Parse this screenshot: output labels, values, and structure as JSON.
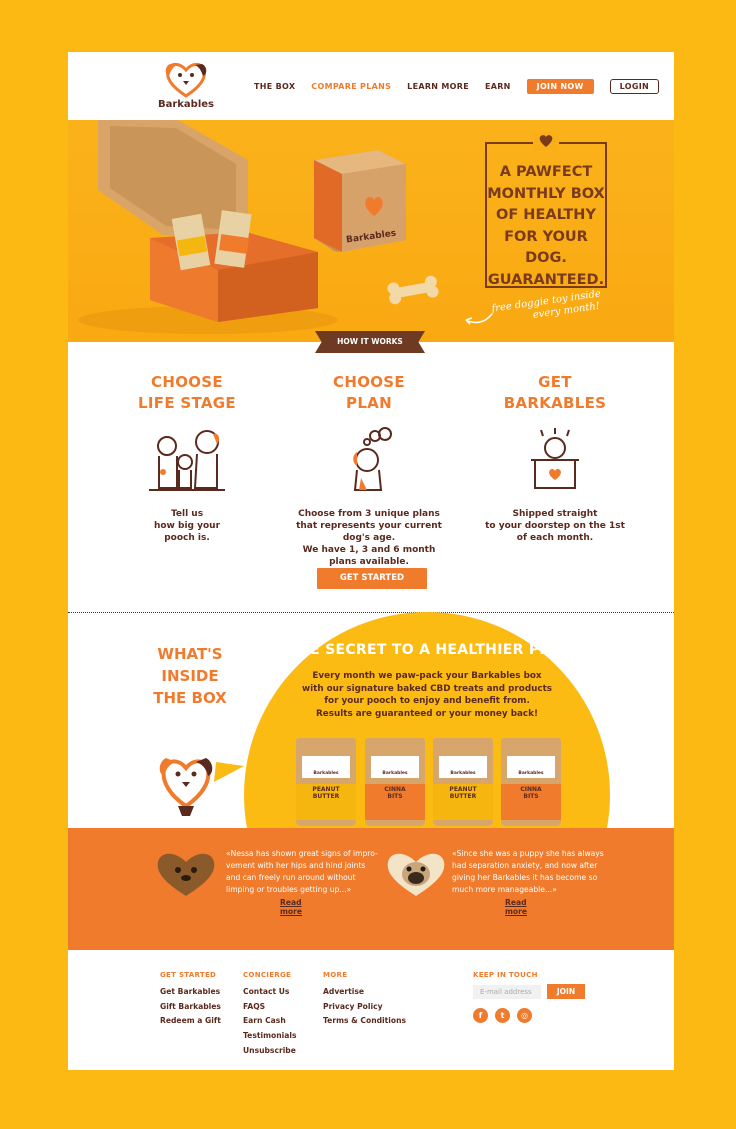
{
  "brand": {
    "name": "Barkables"
  },
  "nav": {
    "items": [
      "THE BOX",
      "COMPARE PLANS",
      "LEARN MORE",
      "EARN"
    ],
    "active_index": 1,
    "join_label": "JOIN NOW",
    "login_label": "LOGIN"
  },
  "hero": {
    "headline": [
      "A PAWFECT",
      "MONTHLY BOX",
      "OF HEALTHY",
      "FOR YOUR DOG.",
      "GUARANTEED."
    ],
    "note_line1": "free doggie toy inside",
    "note_line2": "every month!",
    "box_brand": "Barkables"
  },
  "how_it_works": {
    "tag": "HOW IT WORKS",
    "steps": [
      {
        "title1": "CHOOSE",
        "title2": "LIFE STAGE",
        "text": [
          "Tell us",
          "how big your",
          "pooch is."
        ]
      },
      {
        "title1": "CHOOSE",
        "title2": "PLAN",
        "text": [
          "Choose from 3 unique plans",
          "that represents your current dog's age.",
          "We have 1, 3 and 6 month",
          "plans available."
        ]
      },
      {
        "title1": "GET",
        "title2": "BARKABLES",
        "text": [
          "Shipped straight",
          "to your doorstep on the 1st",
          "of each month."
        ]
      }
    ],
    "cta": "GET STARTED"
  },
  "inside": {
    "title": [
      "WHAT'S",
      "INSIDE",
      "THE BOX"
    ],
    "secret_title": "THE SECRET TO A HEALTHIER PET!",
    "secret_body": [
      "Every month we paw-pack your Barkables box",
      "with our signature baked CBD treats and products",
      "for your pooch to enjoy and benefit from.",
      "Results are guaranteed or your money back!"
    ],
    "products": [
      {
        "brand": "Barkables",
        "name1": "PEANUT",
        "name2": "BUTTER",
        "color": "#F5B70F"
      },
      {
        "brand": "Barkables",
        "name1": "CINNA",
        "name2": "BITS",
        "color": "#F07B2C"
      },
      {
        "brand": "Barkables",
        "name1": "PEANUT",
        "name2": "BUTTER",
        "color": "#F5B70F"
      },
      {
        "brand": "Barkables",
        "name1": "CINNA",
        "name2": "BITS",
        "color": "#F07B2C"
      }
    ]
  },
  "testimonials": [
    {
      "lines": [
        "«Nessa has shown great signs of impro-",
        "vement with her hips and hind joints",
        "and can freely run around without",
        "limping or troubles getting up...»"
      ],
      "more": "Read more"
    },
    {
      "lines": [
        "«Since she was a puppy she has always",
        "had separation anxiety, and now after",
        "giving her Barkables it has become so",
        "much more manageable...»"
      ],
      "more": "Read more"
    }
  ],
  "footer": {
    "cols": [
      {
        "title": "GET STARTED",
        "links": [
          "Get Barkables",
          "Gift Barkables",
          "Redeem a Gift"
        ]
      },
      {
        "title": "CONCIERGE",
        "links": [
          "Contact Us",
          "FAQS",
          "Earn Cash",
          "Testimonials",
          "Unsubscribe"
        ]
      },
      {
        "title": "MORE",
        "links": [
          "Advertise",
          "Privacy Policy",
          "Terms & Conditions"
        ]
      }
    ],
    "keep_title": "KEEP IN TOUCH",
    "email_placeholder": "E-mail address",
    "join_label": "JOIN",
    "social": [
      "f",
      "t",
      "◎"
    ]
  },
  "colors": {
    "orange": "#F07B2C",
    "yellow": "#FDB913",
    "brown": "#5B2A1F"
  }
}
